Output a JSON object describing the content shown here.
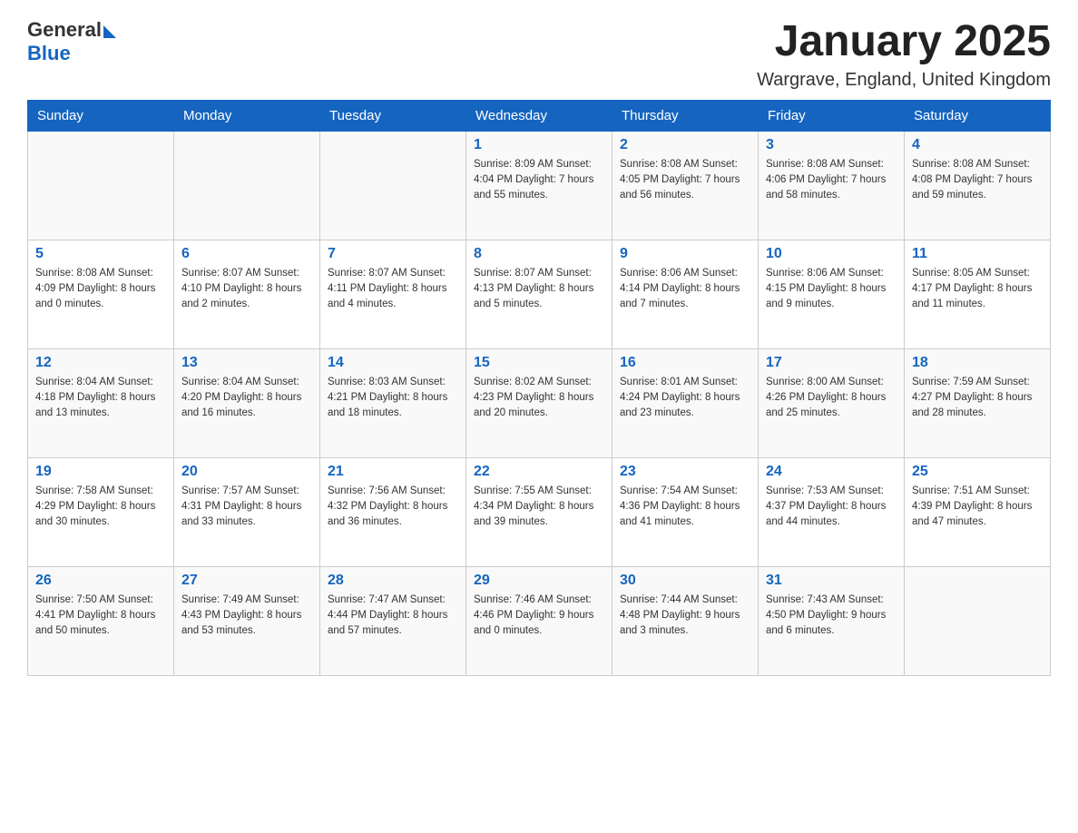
{
  "header": {
    "logo_general": "General",
    "logo_blue": "Blue",
    "title": "January 2025",
    "location": "Wargrave, England, United Kingdom"
  },
  "days_of_week": [
    "Sunday",
    "Monday",
    "Tuesday",
    "Wednesday",
    "Thursday",
    "Friday",
    "Saturday"
  ],
  "weeks": [
    [
      {
        "day": "",
        "info": ""
      },
      {
        "day": "",
        "info": ""
      },
      {
        "day": "",
        "info": ""
      },
      {
        "day": "1",
        "info": "Sunrise: 8:09 AM\nSunset: 4:04 PM\nDaylight: 7 hours\nand 55 minutes."
      },
      {
        "day": "2",
        "info": "Sunrise: 8:08 AM\nSunset: 4:05 PM\nDaylight: 7 hours\nand 56 minutes."
      },
      {
        "day": "3",
        "info": "Sunrise: 8:08 AM\nSunset: 4:06 PM\nDaylight: 7 hours\nand 58 minutes."
      },
      {
        "day": "4",
        "info": "Sunrise: 8:08 AM\nSunset: 4:08 PM\nDaylight: 7 hours\nand 59 minutes."
      }
    ],
    [
      {
        "day": "5",
        "info": "Sunrise: 8:08 AM\nSunset: 4:09 PM\nDaylight: 8 hours\nand 0 minutes."
      },
      {
        "day": "6",
        "info": "Sunrise: 8:07 AM\nSunset: 4:10 PM\nDaylight: 8 hours\nand 2 minutes."
      },
      {
        "day": "7",
        "info": "Sunrise: 8:07 AM\nSunset: 4:11 PM\nDaylight: 8 hours\nand 4 minutes."
      },
      {
        "day": "8",
        "info": "Sunrise: 8:07 AM\nSunset: 4:13 PM\nDaylight: 8 hours\nand 5 minutes."
      },
      {
        "day": "9",
        "info": "Sunrise: 8:06 AM\nSunset: 4:14 PM\nDaylight: 8 hours\nand 7 minutes."
      },
      {
        "day": "10",
        "info": "Sunrise: 8:06 AM\nSunset: 4:15 PM\nDaylight: 8 hours\nand 9 minutes."
      },
      {
        "day": "11",
        "info": "Sunrise: 8:05 AM\nSunset: 4:17 PM\nDaylight: 8 hours\nand 11 minutes."
      }
    ],
    [
      {
        "day": "12",
        "info": "Sunrise: 8:04 AM\nSunset: 4:18 PM\nDaylight: 8 hours\nand 13 minutes."
      },
      {
        "day": "13",
        "info": "Sunrise: 8:04 AM\nSunset: 4:20 PM\nDaylight: 8 hours\nand 16 minutes."
      },
      {
        "day": "14",
        "info": "Sunrise: 8:03 AM\nSunset: 4:21 PM\nDaylight: 8 hours\nand 18 minutes."
      },
      {
        "day": "15",
        "info": "Sunrise: 8:02 AM\nSunset: 4:23 PM\nDaylight: 8 hours\nand 20 minutes."
      },
      {
        "day": "16",
        "info": "Sunrise: 8:01 AM\nSunset: 4:24 PM\nDaylight: 8 hours\nand 23 minutes."
      },
      {
        "day": "17",
        "info": "Sunrise: 8:00 AM\nSunset: 4:26 PM\nDaylight: 8 hours\nand 25 minutes."
      },
      {
        "day": "18",
        "info": "Sunrise: 7:59 AM\nSunset: 4:27 PM\nDaylight: 8 hours\nand 28 minutes."
      }
    ],
    [
      {
        "day": "19",
        "info": "Sunrise: 7:58 AM\nSunset: 4:29 PM\nDaylight: 8 hours\nand 30 minutes."
      },
      {
        "day": "20",
        "info": "Sunrise: 7:57 AM\nSunset: 4:31 PM\nDaylight: 8 hours\nand 33 minutes."
      },
      {
        "day": "21",
        "info": "Sunrise: 7:56 AM\nSunset: 4:32 PM\nDaylight: 8 hours\nand 36 minutes."
      },
      {
        "day": "22",
        "info": "Sunrise: 7:55 AM\nSunset: 4:34 PM\nDaylight: 8 hours\nand 39 minutes."
      },
      {
        "day": "23",
        "info": "Sunrise: 7:54 AM\nSunset: 4:36 PM\nDaylight: 8 hours\nand 41 minutes."
      },
      {
        "day": "24",
        "info": "Sunrise: 7:53 AM\nSunset: 4:37 PM\nDaylight: 8 hours\nand 44 minutes."
      },
      {
        "day": "25",
        "info": "Sunrise: 7:51 AM\nSunset: 4:39 PM\nDaylight: 8 hours\nand 47 minutes."
      }
    ],
    [
      {
        "day": "26",
        "info": "Sunrise: 7:50 AM\nSunset: 4:41 PM\nDaylight: 8 hours\nand 50 minutes."
      },
      {
        "day": "27",
        "info": "Sunrise: 7:49 AM\nSunset: 4:43 PM\nDaylight: 8 hours\nand 53 minutes."
      },
      {
        "day": "28",
        "info": "Sunrise: 7:47 AM\nSunset: 4:44 PM\nDaylight: 8 hours\nand 57 minutes."
      },
      {
        "day": "29",
        "info": "Sunrise: 7:46 AM\nSunset: 4:46 PM\nDaylight: 9 hours\nand 0 minutes."
      },
      {
        "day": "30",
        "info": "Sunrise: 7:44 AM\nSunset: 4:48 PM\nDaylight: 9 hours\nand 3 minutes."
      },
      {
        "day": "31",
        "info": "Sunrise: 7:43 AM\nSunset: 4:50 PM\nDaylight: 9 hours\nand 6 minutes."
      },
      {
        "day": "",
        "info": ""
      }
    ]
  ]
}
